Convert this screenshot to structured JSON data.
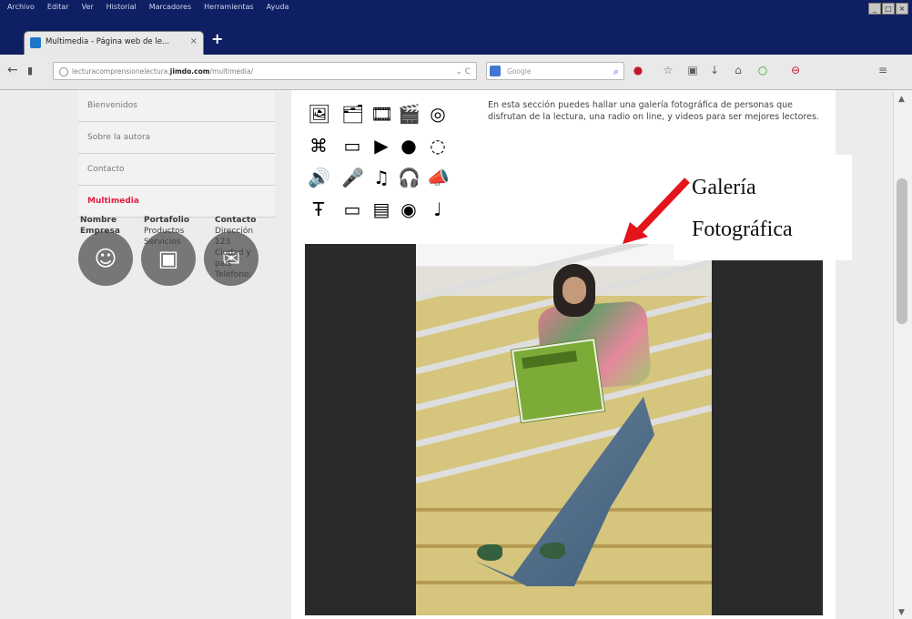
{
  "menu": [
    "Archivo",
    "Editar",
    "Ver",
    "Historial",
    "Marcadores",
    "Herramientas",
    "Ayuda"
  ],
  "window_controls": {
    "minimize": "_",
    "maximize": "□",
    "close": "×"
  },
  "tab": {
    "title": "Multimedia - Página web de le...",
    "close": "×",
    "new_tab": "+"
  },
  "urlbar": {
    "url_prefix": "lecturacomprensionelectura.",
    "url_domain": "jimdo.com",
    "url_path": "/multimedia/",
    "controls": "⌄ C"
  },
  "search": {
    "placeholder": "Google"
  },
  "sidebar": {
    "items": [
      {
        "label": "Bienvenidos"
      },
      {
        "label": "Sobre la autora"
      },
      {
        "label": "Contacto"
      },
      {
        "label": "Multimedia"
      }
    ]
  },
  "footer": {
    "col1": {
      "line1": "Nombre",
      "line2": "Empresa"
    },
    "col2": {
      "title": "Portafolio",
      "line1": "Productos",
      "line2": "Servicios"
    },
    "col3": {
      "title": "Contacto",
      "line1": "Dirección",
      "line2": "123",
      "line3": "Ciudad y",
      "line4": "país",
      "line5": "Teléfono:"
    }
  },
  "intro": "En esta sección puedes hallar una galería fotográfica de personas que disfrutan de la lectura, una radio on line, y videos para ser mejores lectores.",
  "annotation": {
    "line1": "Galería",
    "line2": "Fotográfica"
  },
  "accent_colors": {
    "title_bar": "#0f1f63",
    "active_menu": "#e41d3d",
    "arrow": "#e3141a"
  }
}
